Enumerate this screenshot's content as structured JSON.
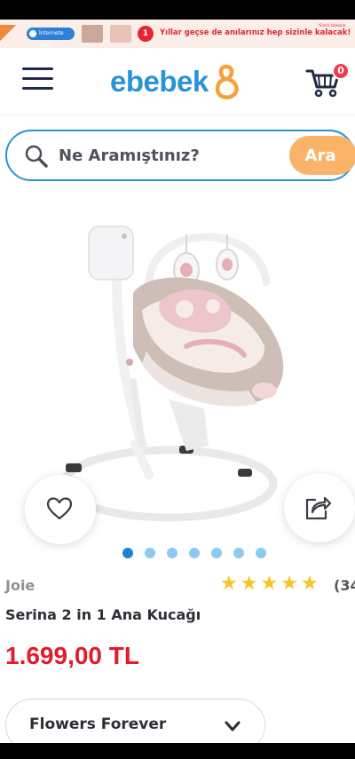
{
  "promo_banner": {
    "pill_label": "İnternete Özel",
    "badge_number": "1",
    "text": "Yıllar geçse de anılarınız hep sizinle kalacak!",
    "note": "*Sınırlı stoklarla"
  },
  "header": {
    "logo_text": "ebebek",
    "cart_count": "0"
  },
  "search": {
    "placeholder": "Ne Aramıştınız?",
    "button_label": "Ara"
  },
  "gallery": {
    "image_label": "Joie",
    "slide_count": 7,
    "active_slide": 1
  },
  "product": {
    "brand": "Joie",
    "rating_stars": 5,
    "rating_count": "(34",
    "title": "Serina 2 in 1 Ana Kucağı",
    "price": "1.699,00 TL"
  },
  "variant": {
    "selected": "Flowers Forever"
  },
  "colors": {
    "brand_blue": "#2a93d5",
    "accent_orange": "#f9b46a",
    "price_red": "#e31b2a",
    "star_yellow": "#f5c52a",
    "badge_red": "#ef3b4b"
  }
}
